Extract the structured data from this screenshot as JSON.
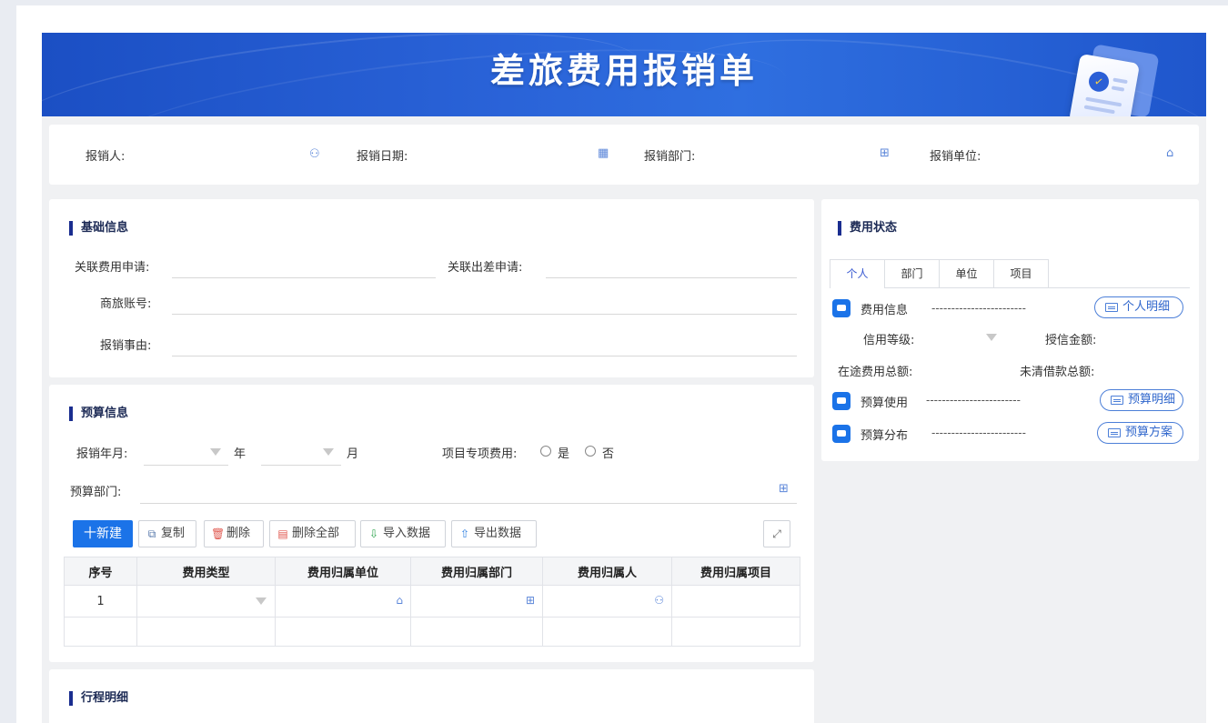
{
  "banner": {
    "title": "差旅费用报销单"
  },
  "header_fields": {
    "reimburser": "报销人:",
    "date": "报销日期:",
    "department": "报销部门:",
    "unit": "报销单位:"
  },
  "basic_info": {
    "title": "基础信息",
    "related_expense_request": "关联费用申请:",
    "related_trip_request": "关联出差申请:",
    "travel_account": "商旅账号:",
    "reason": "报销事由:"
  },
  "budget_info": {
    "title": "预算信息",
    "year_month_label": "报销年月:",
    "year_unit": "年",
    "month_unit": "月",
    "special_label": "项目专项费用:",
    "yes": "是",
    "no": "否",
    "budget_dept_label": "预算部门:"
  },
  "toolbar": {
    "new": "十新建",
    "copy": "复制",
    "delete": "删除",
    "delete_all": "删除全部",
    "import": "导入数据",
    "export": "导出数据"
  },
  "table": {
    "headers": [
      "序号",
      "费用类型",
      "费用归属单位",
      "费用归属部门",
      "费用归属人",
      "费用归属项目"
    ],
    "rows": [
      {
        "index": "1"
      }
    ]
  },
  "itinerary": {
    "title": "行程明细"
  },
  "expense_status": {
    "title": "费用状态",
    "tabs": [
      "个人",
      "部门",
      "单位",
      "项目"
    ],
    "active_tab": "个人",
    "expense_info": "费用信息",
    "personal_detail_btn": "个人明细",
    "credit_level": "信用等级:",
    "credit_amount": "授信金额:",
    "in_transit_total": "在途费用总额:",
    "outstanding_loans": "未清借款总额:",
    "budget_usage": "预算使用",
    "budget_detail_btn": "预算明细",
    "budget_distribution": "预算分布",
    "budget_plan_btn": "预算方案",
    "dash_line": "------------------------"
  }
}
